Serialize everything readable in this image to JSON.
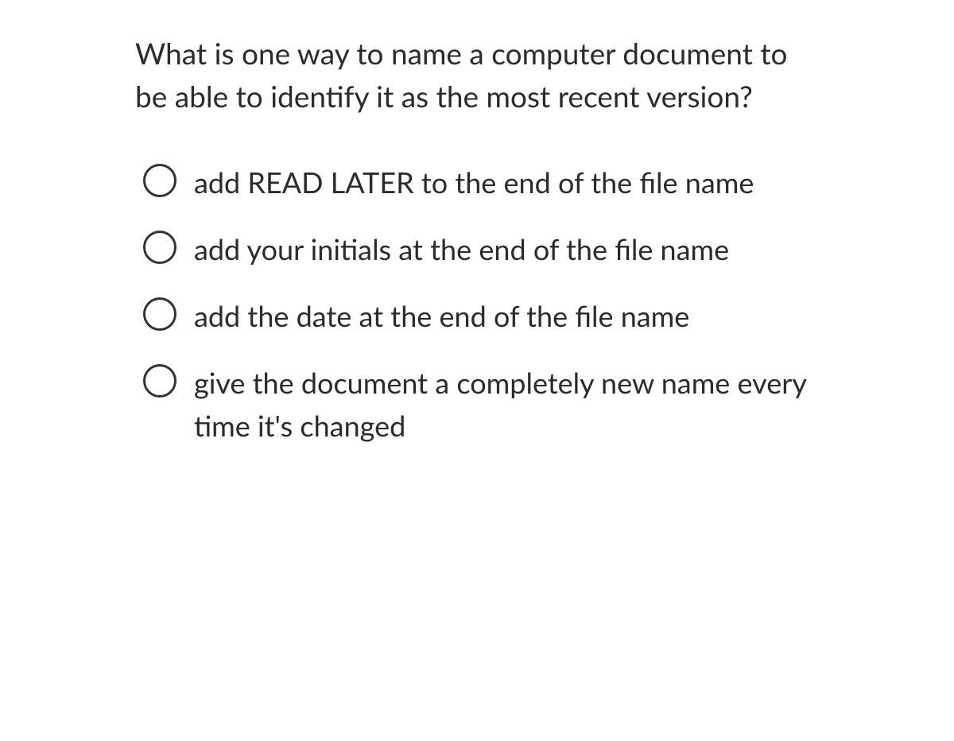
{
  "question": {
    "prompt": "What is one way to name a computer document to be able to identify it as the most recent version?",
    "options": [
      {
        "label": "add READ LATER to the end of the file name"
      },
      {
        "label": "add your initials at the end of the file name"
      },
      {
        "label": "add the date at the end of the file name"
      },
      {
        "label": "give the document a completely new name every time it's changed"
      }
    ]
  }
}
